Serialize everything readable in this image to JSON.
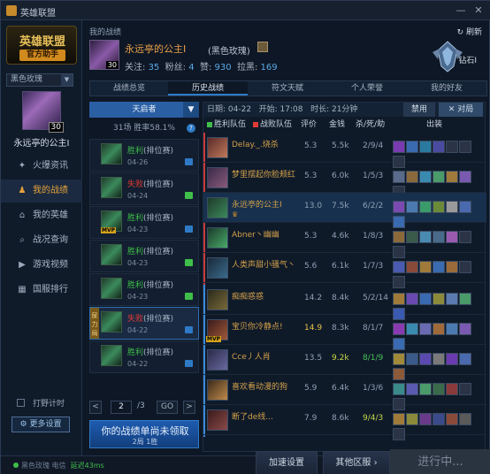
{
  "window": {
    "title": "英雄联盟",
    "min": "—",
    "close": "✕"
  },
  "sidebar": {
    "logo_line1": "英雄联盟",
    "logo_line2": "官方助手",
    "account": "黑色玫瑰",
    "level": "30",
    "name": "永远亭的公主Ⅰ",
    "items": [
      {
        "label": "火爆资讯",
        "icon": "flame-icon",
        "glyph": "✦"
      },
      {
        "label": "我的战绩",
        "icon": "user-icon",
        "glyph": "♟"
      },
      {
        "label": "我的英雄",
        "icon": "home-icon",
        "glyph": "⌂"
      },
      {
        "label": "战况查询",
        "icon": "search-icon",
        "glyph": "⌕"
      },
      {
        "label": "游戏视频",
        "icon": "play-icon",
        "glyph": "▶"
      },
      {
        "label": "国服排行",
        "icon": "ranking-icon",
        "glyph": "▦"
      }
    ],
    "jungle_timer": "打野计时",
    "more_settings": "更多设置"
  },
  "header": {
    "title": "我的战绩",
    "refresh": "刷新",
    "name": "永远亭的公主Ⅰ",
    "server": "(黑色玫瑰)",
    "level": "30",
    "follow_label": "关注:",
    "follow": "35",
    "fans_label": "粉丝:",
    "fans": "4",
    "likes_label": "赞:",
    "likes": "930",
    "dislikes_label": "拉黑:",
    "dislikes": "169",
    "rank": "钻石Ⅰ"
  },
  "tabs": [
    "战绩总览",
    "历史战绩",
    "符文天赋",
    "个人荣誉",
    "我的好友"
  ],
  "match_list": {
    "champion_filter": "天启者",
    "summary": "31场  胜率58.1%",
    "matches": [
      {
        "result": "胜利",
        "mode": "(排位赛)",
        "date": "04-26",
        "win": true,
        "mvp": false
      },
      {
        "result": "失败",
        "mode": "(排位赛)",
        "date": "04-24",
        "win": false,
        "mvp": false
      },
      {
        "result": "胜利",
        "mode": "(排位赛)",
        "date": "04-23",
        "win": true,
        "mvp": true
      },
      {
        "result": "胜利",
        "mode": "(排位赛)",
        "date": "04-23",
        "win": true,
        "mvp": false
      },
      {
        "result": "胜利",
        "mode": "(排位赛)",
        "date": "04-23",
        "win": true,
        "mvp": false
      },
      {
        "result": "失败",
        "mode": "(排位赛)",
        "date": "04-22",
        "win": false,
        "mvp": false,
        "tag": "尿力局"
      },
      {
        "result": "胜利",
        "mode": "(排位赛)",
        "date": "04-22",
        "win": true,
        "mvp": false
      }
    ],
    "page": "2",
    "total_pages": "/3",
    "go": "GO",
    "prev": "<",
    "next": ">",
    "promo_line1": "你的战绩单尚未领取",
    "promo_line2": "2局 1胜"
  },
  "detail": {
    "date": "日期: 04-22",
    "start": "开始: 17:08",
    "duration": "时长: 21分钟",
    "ban": "禁用",
    "vs": "对局",
    "col_win_team": "胜利队伍",
    "col_lose_team": "战败队伍",
    "col_score": "评价",
    "col_gold": "金钱",
    "col_kda": "杀/死/助",
    "col_items": "出装",
    "players": [
      {
        "name": "Delay._.烧杀",
        "score": "5.3",
        "gold": "5.5k",
        "kda": "2/9/4",
        "team": "lose",
        "sub": ""
      },
      {
        "name": "梦里摆起你脸颊红",
        "score": "5.3",
        "gold": "6.0k",
        "kda": "1/5/3",
        "team": "lose",
        "sub": ""
      },
      {
        "name": "永远亭的公主Ⅰ",
        "score": "13.0",
        "gold": "7.5k",
        "kda": "6/2/2",
        "team": "lose",
        "sub": "♛",
        "me": true
      },
      {
        "name": "Abner丶幽幽",
        "score": "5.3",
        "gold": "4.6k",
        "kda": "1/8/3",
        "team": "lose",
        "sub": ""
      },
      {
        "name": "人类声甜小骚气丶",
        "score": "5.6",
        "gold": "6.1k",
        "kda": "1/7/3",
        "team": "lose",
        "sub": ""
      },
      {
        "name": "痴痴惑惑",
        "score": "14.2",
        "gold": "8.4k",
        "kda": "5/2/14",
        "team": "win",
        "sub": ""
      },
      {
        "name": "宝贝你冷静点!",
        "score": "14.9",
        "gold": "8.3k",
        "kda": "8/1/7",
        "team": "win",
        "sub": "",
        "mvp": true
      },
      {
        "name": "Cce丿人肖",
        "score": "13.5",
        "gold": "9.2k",
        "kda": "8/1/9",
        "team": "win",
        "sub": ""
      },
      {
        "name": "喜欢看动漫的狗",
        "score": "5.9",
        "gold": "6.4k",
        "kda": "1/3/6",
        "team": "win",
        "sub": ""
      },
      {
        "name": "断了de线...",
        "score": "7.9",
        "gold": "8.6k",
        "kda": "9/4/3",
        "team": "win",
        "sub": ""
      }
    ]
  },
  "footer": {
    "server_status": "黑色玫瑰  电信",
    "latency": "延迟43ms",
    "accelerate": "加速设置",
    "other_servers": "其他区服",
    "start": "进行中..."
  },
  "colors": {
    "accent": "#2f7ac6",
    "win": "#3fbf4a",
    "lose": "#e23b35",
    "gold": "#e8a04a"
  }
}
